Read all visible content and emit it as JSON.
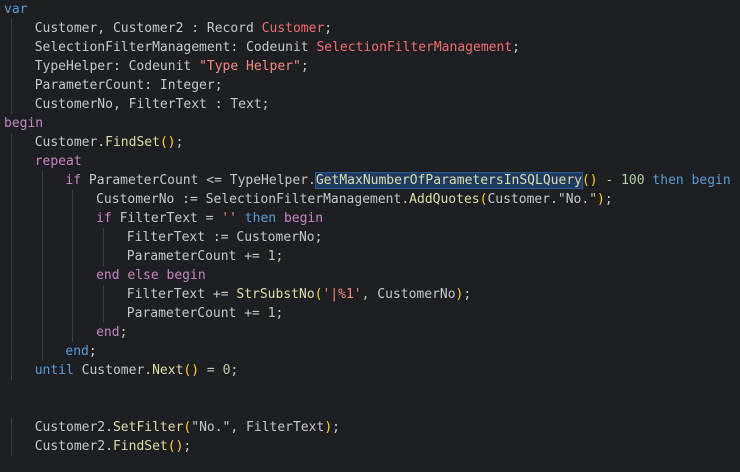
{
  "editor": {
    "background": "#1e1f22",
    "lines": [
      {
        "indent": 0,
        "tokens": [
          {
            "t": "var",
            "c": "kw"
          }
        ]
      },
      {
        "indent": 1,
        "tokens": [
          {
            "t": "Customer, Customer2 : Record ",
            "c": "ident"
          },
          {
            "t": "Customer",
            "c": "type"
          },
          {
            "t": ";",
            "c": "ident"
          }
        ]
      },
      {
        "indent": 1,
        "tokens": [
          {
            "t": "SelectionFilterManagement: Codeunit ",
            "c": "ident"
          },
          {
            "t": "SelectionFilterManagement",
            "c": "type"
          },
          {
            "t": ";",
            "c": "ident"
          }
        ]
      },
      {
        "indent": 1,
        "tokens": [
          {
            "t": "TypeHelper: Codeunit ",
            "c": "ident"
          },
          {
            "t": "\"Type Helper\"",
            "c": "str"
          },
          {
            "t": ";",
            "c": "ident"
          }
        ]
      },
      {
        "indent": 1,
        "tokens": [
          {
            "t": "ParameterCount: Integer;",
            "c": "ident"
          }
        ]
      },
      {
        "indent": 1,
        "tokens": [
          {
            "t": "CustomerNo, FilterText : Text;",
            "c": "ident"
          }
        ]
      },
      {
        "indent": 0,
        "tokens": [
          {
            "t": "begin",
            "c": "kwp"
          }
        ]
      },
      {
        "indent": 1,
        "tokens": [
          {
            "t": "Customer.",
            "c": "ident"
          },
          {
            "t": "FindSet",
            "c": "fn"
          },
          {
            "t": "()",
            "c": "p1"
          },
          {
            "t": ";",
            "c": "ident"
          }
        ]
      },
      {
        "indent": 1,
        "tokens": [
          {
            "t": "repeat",
            "c": "kwp"
          }
        ]
      },
      {
        "indent": 2,
        "tokens": [
          {
            "t": "if ",
            "c": "kwp"
          },
          {
            "t": "ParameterCount <= TypeHelper.",
            "c": "ident"
          },
          {
            "t": "GetMaxNumberOfParametersInSQLQuery",
            "c": "fn hl"
          },
          {
            "t": "()",
            "c": "p1"
          },
          {
            "t": " - ",
            "c": "ident"
          },
          {
            "t": "100",
            "c": "num"
          },
          {
            "t": " then begin",
            "c": "kw"
          }
        ]
      },
      {
        "indent": 3,
        "tokens": [
          {
            "t": "CustomerNo := SelectionFilterManagement.",
            "c": "ident"
          },
          {
            "t": "AddQuotes",
            "c": "fn"
          },
          {
            "t": "(",
            "c": "p1"
          },
          {
            "t": "Customer.\"No.\"",
            "c": "ident"
          },
          {
            "t": ")",
            "c": "p1"
          },
          {
            "t": ";",
            "c": "ident"
          }
        ]
      },
      {
        "indent": 3,
        "tokens": [
          {
            "t": "if ",
            "c": "kwp"
          },
          {
            "t": "FilterText = ",
            "c": "ident"
          },
          {
            "t": "''",
            "c": "str"
          },
          {
            "t": " then ",
            "c": "kw"
          },
          {
            "t": "begin",
            "c": "kwp"
          }
        ]
      },
      {
        "indent": 4,
        "tokens": [
          {
            "t": "FilterText := CustomerNo;",
            "c": "ident"
          }
        ]
      },
      {
        "indent": 4,
        "tokens": [
          {
            "t": "ParameterCount += ",
            "c": "ident"
          },
          {
            "t": "1",
            "c": "num"
          },
          {
            "t": ";",
            "c": "ident"
          }
        ]
      },
      {
        "indent": 3,
        "tokens": [
          {
            "t": "end else begin",
            "c": "kwp"
          }
        ]
      },
      {
        "indent": 4,
        "tokens": [
          {
            "t": "FilterText += ",
            "c": "ident"
          },
          {
            "t": "StrSubstNo",
            "c": "fn"
          },
          {
            "t": "(",
            "c": "p1"
          },
          {
            "t": "'|%1'",
            "c": "str"
          },
          {
            "t": ", CustomerNo",
            "c": "ident"
          },
          {
            "t": ")",
            "c": "p1"
          },
          {
            "t": ";",
            "c": "ident"
          }
        ]
      },
      {
        "indent": 4,
        "tokens": [
          {
            "t": "ParameterCount += ",
            "c": "ident"
          },
          {
            "t": "1",
            "c": "num"
          },
          {
            "t": ";",
            "c": "ident"
          }
        ]
      },
      {
        "indent": 3,
        "tokens": [
          {
            "t": "end",
            "c": "kwp"
          },
          {
            "t": ";",
            "c": "ident"
          }
        ]
      },
      {
        "indent": 2,
        "tokens": [
          {
            "t": "end",
            "c": "kw"
          },
          {
            "t": ";",
            "c": "ident"
          }
        ]
      },
      {
        "indent": 1,
        "tokens": [
          {
            "t": "until ",
            "c": "kw"
          },
          {
            "t": "Customer.",
            "c": "ident"
          },
          {
            "t": "Next",
            "c": "fn"
          },
          {
            "t": "()",
            "c": "p1"
          },
          {
            "t": " = ",
            "c": "ident"
          },
          {
            "t": "0",
            "c": "num"
          },
          {
            "t": ";",
            "c": "ident"
          }
        ]
      },
      {
        "indent": 0,
        "tokens": []
      },
      {
        "indent": 0,
        "tokens": []
      },
      {
        "indent": 1,
        "tokens": [
          {
            "t": "Customer2.",
            "c": "ident"
          },
          {
            "t": "SetFilter",
            "c": "fn"
          },
          {
            "t": "(",
            "c": "p1"
          },
          {
            "t": "\"No.\", FilterText",
            "c": "ident"
          },
          {
            "t": ")",
            "c": "p1"
          },
          {
            "t": ";",
            "c": "ident"
          }
        ]
      },
      {
        "indent": 1,
        "tokens": [
          {
            "t": "Customer2.",
            "c": "ident"
          },
          {
            "t": "FindSet",
            "c": "fn"
          },
          {
            "t": "()",
            "c": "p1"
          },
          {
            "t": ";",
            "c": "ident"
          }
        ]
      }
    ]
  }
}
